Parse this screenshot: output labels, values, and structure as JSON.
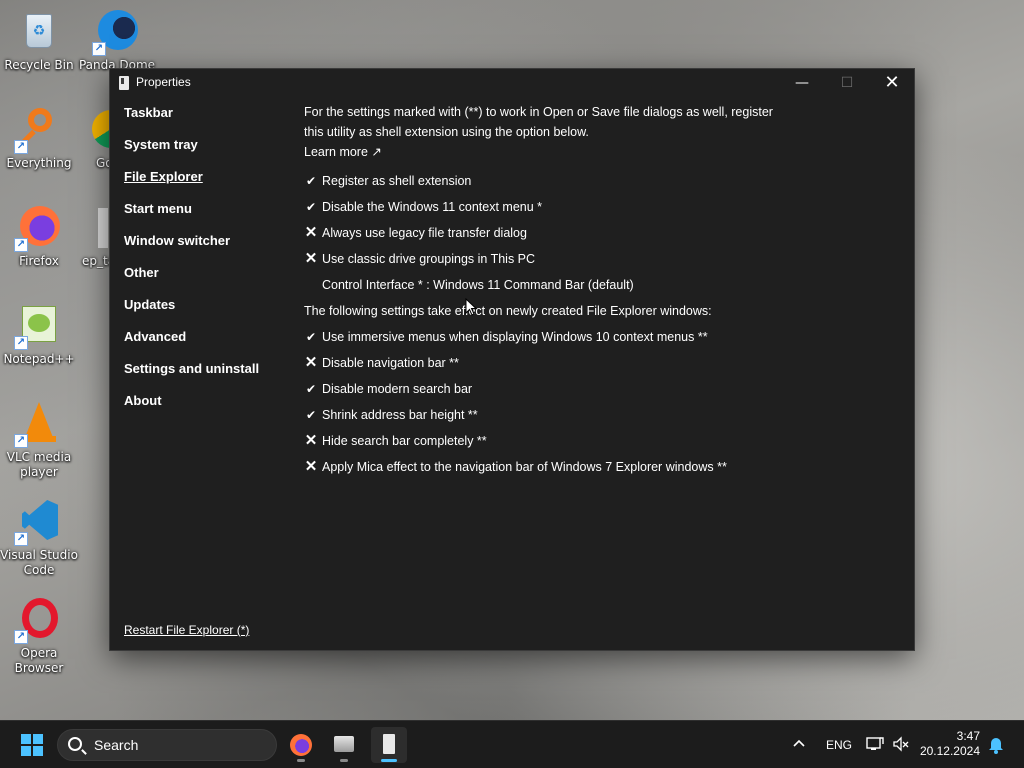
{
  "desktop": {
    "icons": [
      {
        "label": "Recycle Bin",
        "icon": "recycle-bin-icon"
      },
      {
        "label": "Panda Dome",
        "icon": "panda-dome-icon"
      },
      {
        "label": "Everything",
        "icon": "everything-search-icon"
      },
      {
        "label": "Go Ch",
        "icon": "chrome-icon"
      },
      {
        "label": "Firefox",
        "icon": "firefox-icon"
      },
      {
        "label": "ep_ta",
        "icon": "ep-taskbar-icon"
      },
      {
        "label": "Notepad++",
        "icon": "notepad-plus-plus-icon"
      },
      {
        "label": "VLC media player",
        "icon": "vlc-icon"
      },
      {
        "label": "Visual Studio Code",
        "icon": "vscode-icon"
      },
      {
        "label": "Opera Browser",
        "icon": "opera-icon"
      }
    ]
  },
  "window": {
    "title": "Properties",
    "controls": {
      "minimize": "—",
      "maximize": "☐",
      "close": "✕"
    },
    "nav": [
      {
        "label": "Taskbar",
        "active": false
      },
      {
        "label": "System tray",
        "active": false
      },
      {
        "label": "File Explorer",
        "active": true
      },
      {
        "label": "Start menu",
        "active": false
      },
      {
        "label": "Window switcher",
        "active": false
      },
      {
        "label": "Other",
        "active": false
      },
      {
        "label": "Updates",
        "active": false
      },
      {
        "label": "Advanced",
        "active": false
      },
      {
        "label": "Settings and uninstall",
        "active": false
      },
      {
        "label": "About",
        "active": false
      }
    ],
    "restart_link": "Restart File Explorer (*)",
    "content": {
      "intro_line1": "For the settings marked with (**) to work in Open or Save file dialogs as well, register",
      "intro_line2": "this utility as shell extension using the option below.",
      "learn_more": "Learn more ↗",
      "options_a": [
        {
          "mark": "✔",
          "label": "Register as shell extension"
        },
        {
          "mark": "✔",
          "label": "Disable the Windows 11 context menu *"
        },
        {
          "mark": "✕",
          "label": "Always use legacy file transfer dialog"
        },
        {
          "mark": "✕",
          "label": "Use classic drive groupings in This PC"
        },
        {
          "mark": "",
          "label": "Control Interface * : Windows 11 Command Bar (default)"
        }
      ],
      "section_label": "The following settings take effect on newly created File Explorer windows:",
      "options_b": [
        {
          "mark": "✔",
          "label": "Use immersive menus when displaying Windows 10 context menus **"
        },
        {
          "mark": "✕",
          "label": "Disable navigation bar **"
        },
        {
          "mark": "✔",
          "label": "Disable modern search bar"
        },
        {
          "mark": "✔",
          "label": "Shrink address bar height **"
        },
        {
          "mark": "✕",
          "label": "Hide search bar completely **"
        },
        {
          "mark": "✕",
          "label": "Apply Mica effect to the navigation bar of Windows 7 Explorer windows **"
        }
      ]
    }
  },
  "taskbar": {
    "search_label": "Search",
    "language": "ENG",
    "time": "3:47",
    "date": "20.12.2024",
    "accent": "#4cc2ff"
  }
}
